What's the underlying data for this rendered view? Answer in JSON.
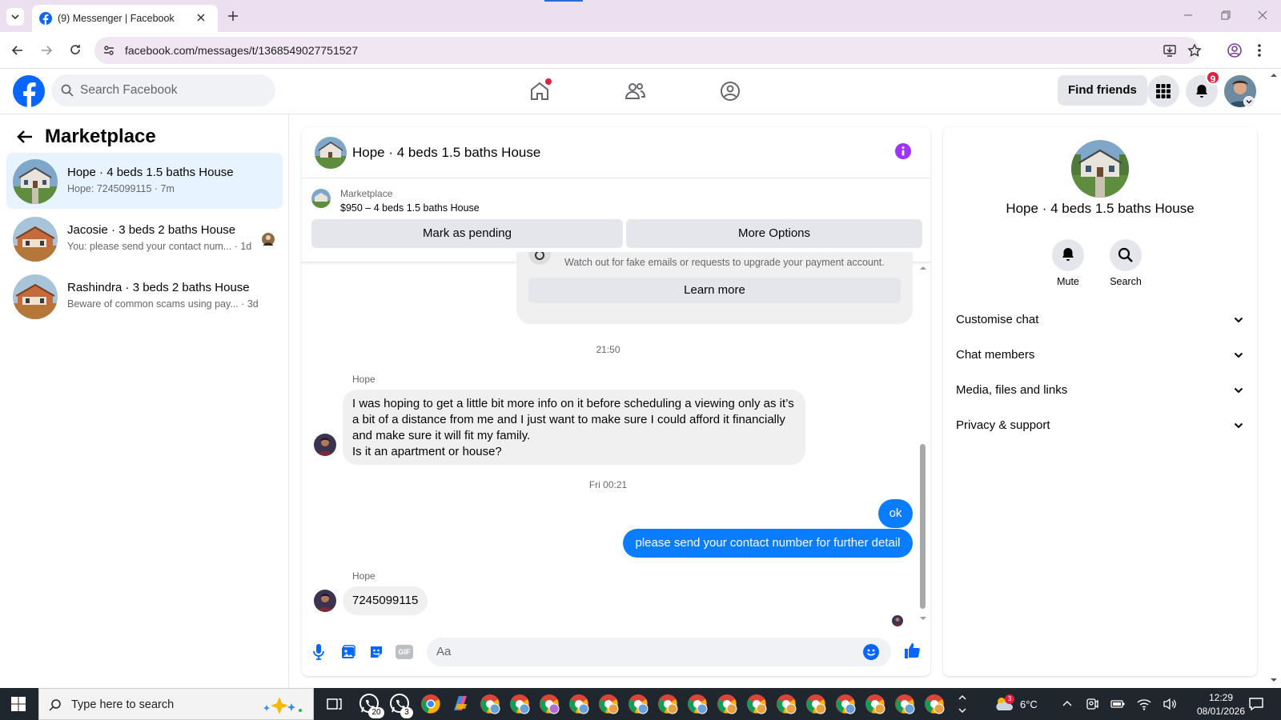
{
  "browser": {
    "tab_title": "(9) Messenger | Facebook",
    "url": "facebook.com/messages/t/1368549027751527"
  },
  "header": {
    "search_placeholder": "Search Facebook",
    "find_friends": "Find friends",
    "notifications_count": "9",
    "brand_color": "#0866ff"
  },
  "sidebar": {
    "title": "Marketplace",
    "conversations": [
      {
        "name": "Hope · 4 beds 1.5 baths House",
        "preview": "Hope: 7245099115 · 7m",
        "active": true
      },
      {
        "name": "Jacosie · 3 beds 2 baths House",
        "preview": "You: please send your contact num... · 1d",
        "active": false
      },
      {
        "name": "Rashindra · 3 beds 2 baths House",
        "preview": "Beware of common scams using pay...   · 3d",
        "active": false
      }
    ]
  },
  "chat": {
    "title": "Hope · 4 beds 1.5 baths House",
    "listing_source": "Marketplace",
    "listing_desc": "$950 – 4 beds 1.5 baths House",
    "mark_pending": "Mark as pending",
    "more_options": "More Options",
    "warning_text": "Watch out for fake emails or requests to upgrade your payment account.",
    "learn_more": "Learn more",
    "ts1": "21:50",
    "sender1": "Hope",
    "msg1_lines": [
      "I was hoping to get a little bit more info on it before scheduling a viewing only as it’s",
      "a bit of a distance from me and I just want to make sure I could afford it financially",
      "and make sure it will fit my family.",
      "Is it an apartment or house?"
    ],
    "ts2": "Fri 00:21",
    "out1": "ok",
    "out2": "please send your contact number for further detail",
    "sender2": "Hope",
    "msg2": "7245099115",
    "input_placeholder": "Aa",
    "outgoing_color": "#0a7cff"
  },
  "info_panel": {
    "title": "Hope · 4 beds 1.5 baths House",
    "mute": "Mute",
    "search": "Search",
    "sections": [
      "Customise chat",
      "Chat members",
      "Media, files and links",
      "Privacy & support"
    ]
  },
  "taskbar": {
    "search_placeholder": "Type here to search",
    "whatsapp_badge_1": "20",
    "whatsapp_badge_2": "3",
    "weather": "6°C",
    "weather_badge": "3",
    "time": "12:29",
    "date": "08/01/2026"
  }
}
